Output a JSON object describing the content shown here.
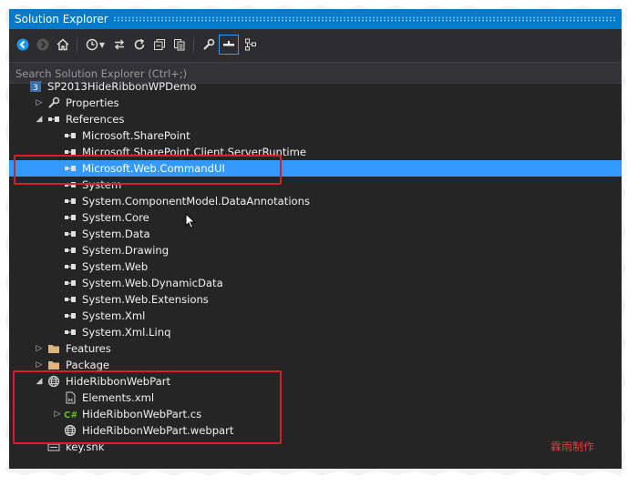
{
  "window": {
    "title": "Solution Explorer"
  },
  "toolbar": {
    "buttons": [
      {
        "name": "back-button",
        "icon": "back-arrow-icon"
      },
      {
        "name": "forward-button",
        "icon": "forward-arrow-icon"
      },
      {
        "name": "home-button",
        "icon": "home-icon"
      },
      {
        "name": "pending-changes-filter-button",
        "icon": "clock-icon"
      },
      {
        "name": "sync-with-document-button",
        "icon": "sync-arrows-icon"
      },
      {
        "name": "refresh-button",
        "icon": "refresh-icon"
      },
      {
        "name": "collapse-all-button",
        "icon": "collapse-all-icon"
      },
      {
        "name": "show-all-files-button",
        "icon": "copy-pages-icon"
      },
      {
        "name": "properties-button",
        "icon": "wrench-icon"
      },
      {
        "name": "preview-selected-button",
        "icon": "preview-icon"
      },
      {
        "name": "class-diagram-button",
        "icon": "diagram-icon"
      }
    ]
  },
  "search": {
    "placeholder": "Search Solution Explorer (Ctrl+;)"
  },
  "tree": {
    "items": [
      {
        "label": "SP2013HideRibbonWPDemo",
        "icon": "csharp-project-icon",
        "level": 0,
        "expander": "none"
      },
      {
        "label": "Properties",
        "icon": "wrench-icon",
        "level": 1,
        "expander": "collapsed"
      },
      {
        "label": "References",
        "icon": "reference-icon",
        "level": 1,
        "expander": "expanded"
      },
      {
        "label": "Microsoft.SharePoint",
        "icon": "reference-icon",
        "level": 2,
        "expander": "none"
      },
      {
        "label": "Microsoft.SharePoint.Client.ServerRuntime",
        "icon": "reference-icon",
        "level": 2,
        "expander": "none"
      },
      {
        "label": "Microsoft.Web.CommandUI",
        "icon": "reference-icon",
        "level": 2,
        "expander": "none",
        "selected": true
      },
      {
        "label": "System",
        "icon": "reference-icon",
        "level": 2,
        "expander": "none"
      },
      {
        "label": "System.ComponentModel.DataAnnotations",
        "icon": "reference-icon",
        "level": 2,
        "expander": "none"
      },
      {
        "label": "System.Core",
        "icon": "reference-icon",
        "level": 2,
        "expander": "none"
      },
      {
        "label": "System.Data",
        "icon": "reference-icon",
        "level": 2,
        "expander": "none"
      },
      {
        "label": "System.Drawing",
        "icon": "reference-icon",
        "level": 2,
        "expander": "none"
      },
      {
        "label": "System.Web",
        "icon": "reference-icon",
        "level": 2,
        "expander": "none"
      },
      {
        "label": "System.Web.DynamicData",
        "icon": "reference-icon",
        "level": 2,
        "expander": "none"
      },
      {
        "label": "System.Web.Extensions",
        "icon": "reference-icon",
        "level": 2,
        "expander": "none"
      },
      {
        "label": "System.Xml",
        "icon": "reference-icon",
        "level": 2,
        "expander": "none"
      },
      {
        "label": "System.Xml.Linq",
        "icon": "reference-icon",
        "level": 2,
        "expander": "none"
      },
      {
        "label": "Features",
        "icon": "folder-icon",
        "level": 1,
        "expander": "collapsed"
      },
      {
        "label": "Package",
        "icon": "folder-icon",
        "level": 1,
        "expander": "collapsed"
      },
      {
        "label": "HideRibbonWebPart",
        "icon": "webpart-globe-icon",
        "level": 1,
        "expander": "expanded"
      },
      {
        "label": "Elements.xml",
        "icon": "xml-file-icon",
        "level": 2,
        "expander": "none"
      },
      {
        "label": "HideRibbonWebPart.cs",
        "icon": "csharp-file-icon",
        "level": 2,
        "expander": "collapsed"
      },
      {
        "label": "HideRibbonWebPart.webpart",
        "icon": "webpart-globe-icon",
        "level": 2,
        "expander": "none"
      },
      {
        "label": "key.snk",
        "icon": "key-file-icon",
        "level": 1,
        "expander": "none"
      }
    ]
  },
  "watermark": "霖雨制作",
  "colors": {
    "accent": "#007acc",
    "selection": "#3399ff",
    "background": "#252526",
    "highlight_box": "#d92020"
  }
}
